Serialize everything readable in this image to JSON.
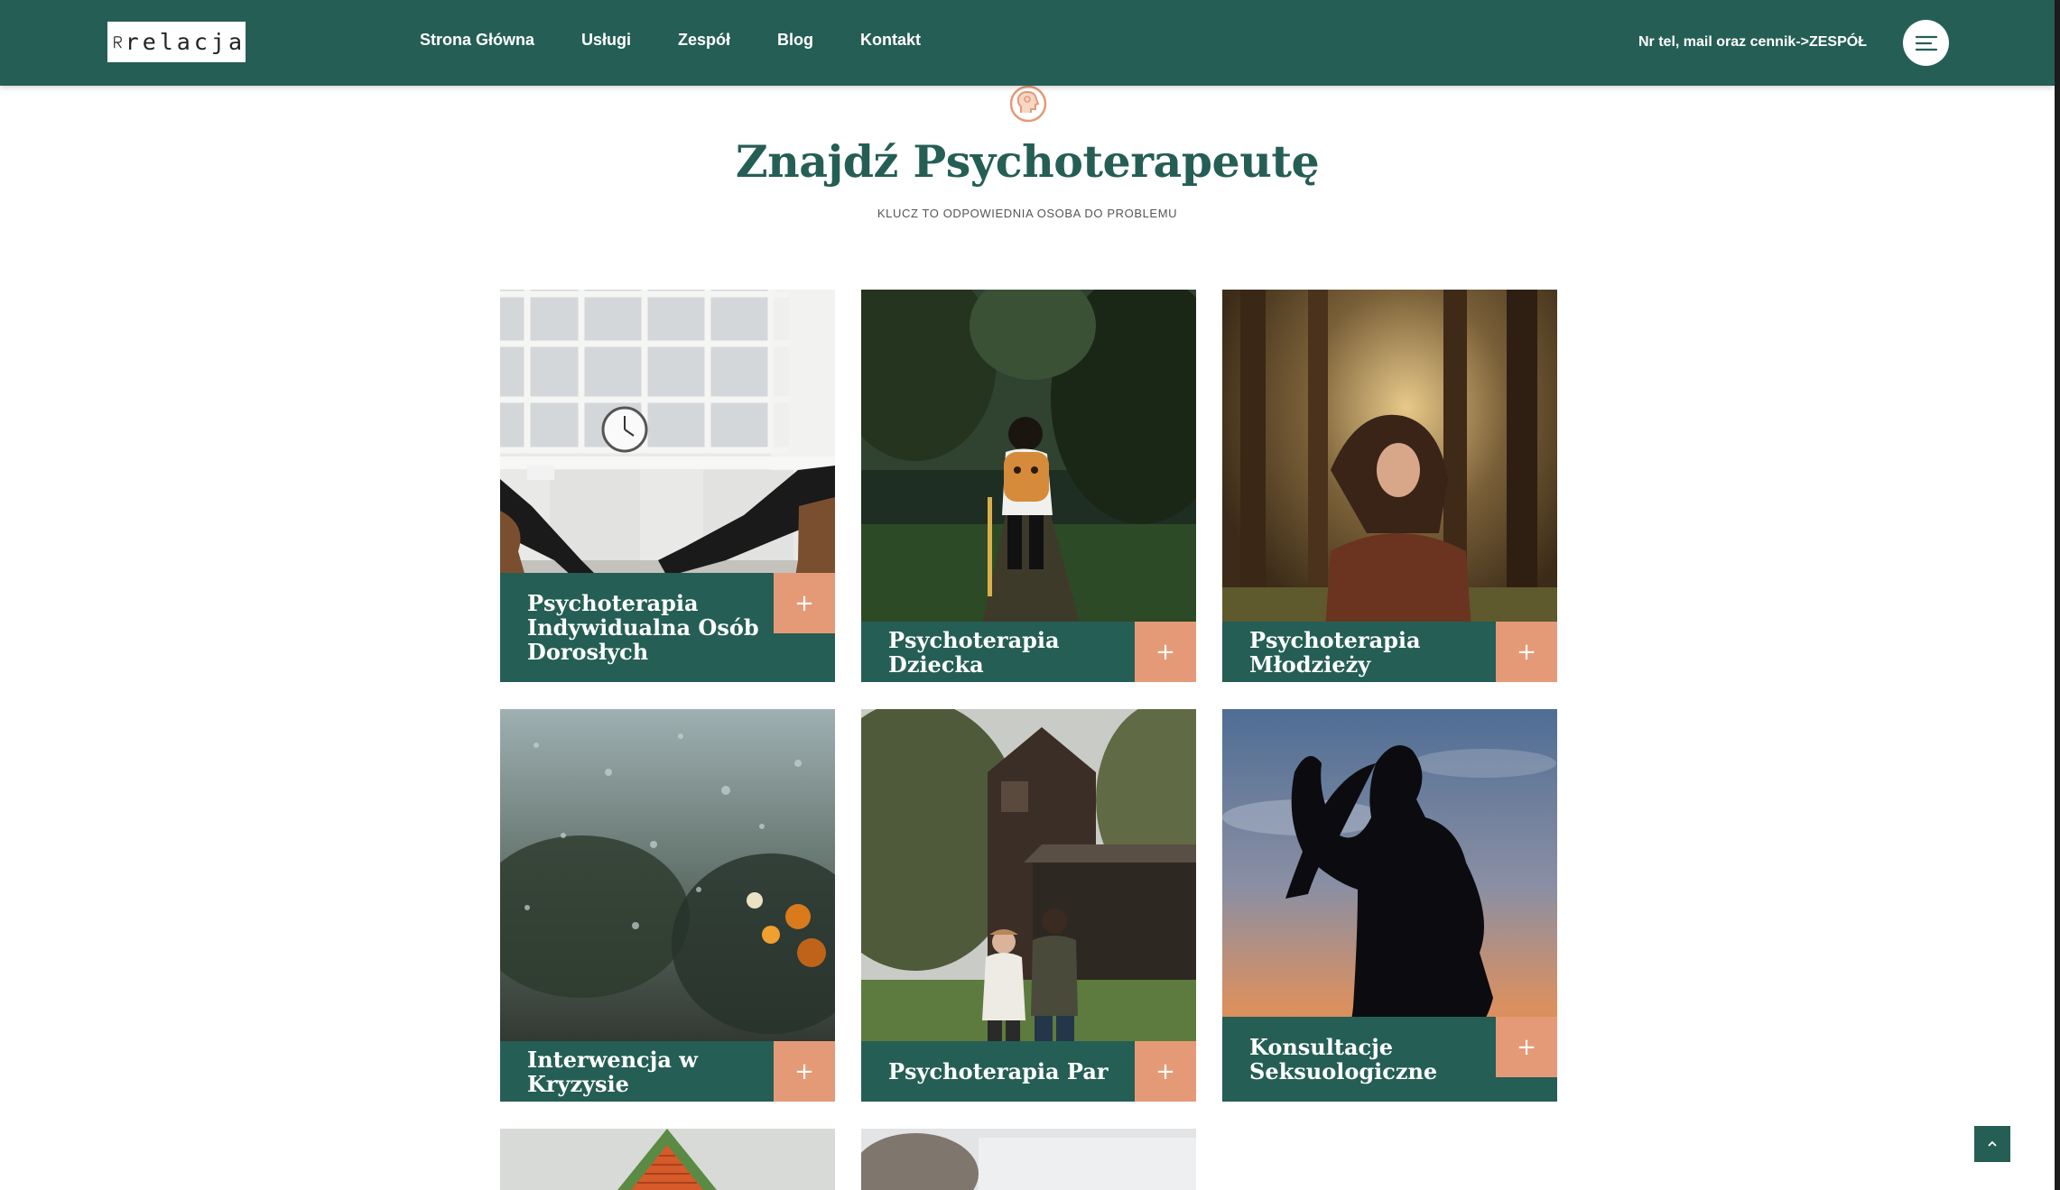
{
  "header": {
    "logo_text": "relacja",
    "nav": [
      "Strona Główna",
      "Usługi",
      "Zespół",
      "Blog",
      "Kontakt"
    ],
    "note": "Nr tel, mail oraz cennik->ZESPÓŁ",
    "menu_icon": "hamburger-icon"
  },
  "section": {
    "icon": "head-icon",
    "title": "Znajdź Psychoterapeutę",
    "subtitle": "KLUCZ TO ODPOWIEDNIA OSOBA DO PROBLEMU"
  },
  "cards": [
    {
      "title": "Psychoterapia Indywidualna Osób Dorosłych",
      "plus": "+"
    },
    {
      "title": "Psychoterapia Dziecka",
      "plus": "+"
    },
    {
      "title": "Psychoterapia Młodzieży",
      "plus": "+"
    },
    {
      "title": "Interwencja w Kryzysie",
      "plus": "+"
    },
    {
      "title": "Psychoterapia Par",
      "plus": "+"
    },
    {
      "title": "Konsultacje Seksuologiczne",
      "plus": "+"
    }
  ],
  "colors": {
    "brand_green": "#255e55",
    "accent_peach": "#e59a77"
  },
  "scroll_top_icon": "chevron-up-icon"
}
